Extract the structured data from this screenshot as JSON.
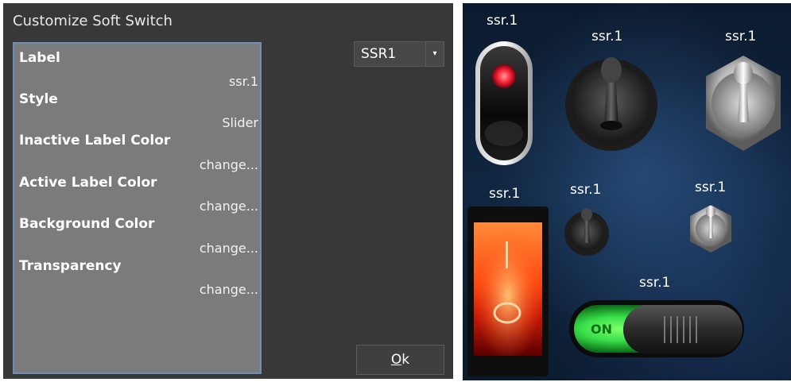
{
  "dialog": {
    "title": "Customize Soft Switch",
    "properties": [
      {
        "label": "Label",
        "value": "ssr.1"
      },
      {
        "label": "Style",
        "value": "Slider"
      },
      {
        "label": "Inactive Label Color",
        "value": "change..."
      },
      {
        "label": "Active Label Color",
        "value": "change..."
      },
      {
        "label": "Background Color",
        "value": "change..."
      },
      {
        "label": "Transparency",
        "value": "change..."
      }
    ],
    "switch_select": {
      "value": "SSR1",
      "arrow_icon": "dropdown-arrow-icon"
    },
    "ok_button": {
      "prefix": "",
      "underlined": "O",
      "rest": "k"
    }
  },
  "preview": {
    "labels": [
      "ssr.1",
      "ssr.1",
      "ssr.1",
      "ssr.1",
      "ssr.1",
      "ssr.1",
      "ssr.1"
    ],
    "slider_on_text": "ON",
    "colors": {
      "led_red": "#ff2a3a",
      "rocker_orange": "#ff6a14",
      "slider_green": "#39e04a"
    }
  }
}
